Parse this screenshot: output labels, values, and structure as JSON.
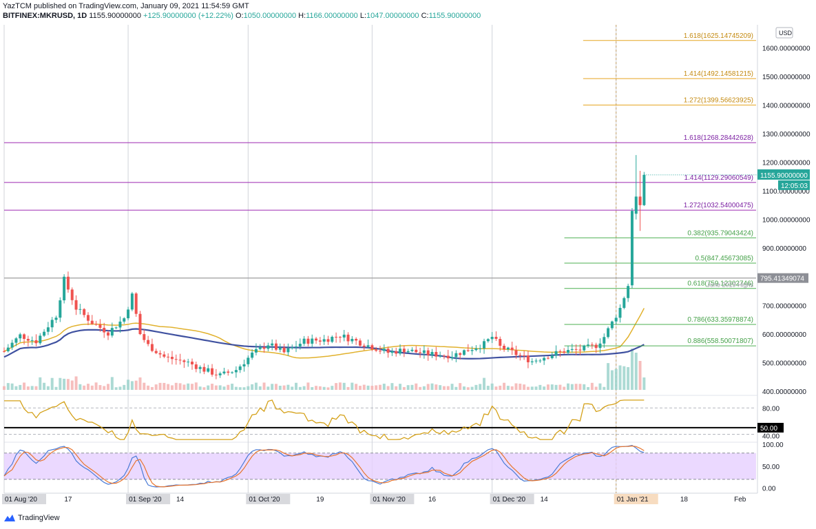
{
  "header": {
    "line1": "YazTCM published on TradingView.com, January 09, 2021 11:54:59 GMT",
    "symbol": "BITFINEX:MKRUSD, 1D",
    "last": "1155.90000000",
    "change": "+125.90000000 (+12.22%)",
    "open_label": "O:",
    "open": "1050.00000000",
    "high_label": "H:",
    "high": "1166.00000000",
    "low_label": "L:",
    "low": "1047.00000000",
    "close_label": "C:",
    "close": "1155.90000000"
  },
  "footer": {
    "brand": "TradingView"
  },
  "colors": {
    "up": "#26a69a",
    "down": "#ef5350",
    "fib_orange": "#e6a520",
    "fib_purple": "#9c27b0",
    "fib_green": "#4caf50",
    "ma_orange": "#e1b12c",
    "ma_blue": "#3f51a0",
    "rsi": "#d4a017",
    "stoch_k": "#4a7bd6",
    "stoch_d": "#e8742c",
    "stoch_band": "#e6d0ff"
  },
  "chart_data": {
    "type": "candlestick",
    "currency_badge": "USD",
    "price_axis": {
      "ylim": [
        400,
        1680
      ],
      "ticks": [
        {
          "v": 1600,
          "label": "1600.00000000"
        },
        {
          "v": 1500,
          "label": "1500.00000000"
        },
        {
          "v": 1400,
          "label": "1400.00000000"
        },
        {
          "v": 1300,
          "label": "1300.00000000"
        },
        {
          "v": 1200,
          "label": "1200.00000000"
        },
        {
          "v": 1100,
          "label": "1100.00000000"
        },
        {
          "v": 1000,
          "label": "1000.00000000"
        },
        {
          "v": 900,
          "label": "900.00000000"
        },
        {
          "v": 700,
          "label": "700.00000000"
        },
        {
          "v": 600,
          "label": "600.00000000"
        },
        {
          "v": 500,
          "label": "500.00000000"
        },
        {
          "v": 400,
          "label": "400.00000000"
        }
      ],
      "last_price_tag": {
        "v": 1155.9,
        "label": "1155.90000000",
        "countdown": "12:05:03"
      },
      "june_high_tag": {
        "v": 795.41349074,
        "label": "795.41349074",
        "note": "June 2019 Highs"
      }
    },
    "fib_levels": [
      {
        "v": 1625.14745209,
        "label": "1.618(1625.14745209)",
        "color": "#e6a520",
        "x_from": 0.77
      },
      {
        "v": 1492.14581215,
        "label": "1.414(1492.14581215)",
        "color": "#e6a520",
        "x_from": 0.77
      },
      {
        "v": 1399.56623925,
        "label": "1.272(1399.56623925)",
        "color": "#e6a520",
        "x_from": 0.77
      },
      {
        "v": 1268.28442628,
        "label": "1.618(1268.28442628)",
        "color": "#9c27b0",
        "x_from": 0.0
      },
      {
        "v": 1129.29060549,
        "label": "1.414(1129.29060549)",
        "color": "#9c27b0",
        "x_from": 0.0
      },
      {
        "v": 1032.54000475,
        "label": "1.272(1032.54000475)",
        "color": "#9c27b0",
        "x_from": 0.0
      },
      {
        "v": 935.79043424,
        "label": "0.382(935.79043424)",
        "color": "#4caf50",
        "x_from": 0.745
      },
      {
        "v": 847.45673085,
        "label": "0.5(847.45673085)",
        "color": "#4caf50",
        "x_from": 0.745
      },
      {
        "v": 759.12302746,
        "label": "0.618(759.12302746)",
        "color": "#4caf50",
        "x_from": 0.745
      },
      {
        "v": 633.35978874,
        "label": "0.786(633.35978874)",
        "color": "#4caf50",
        "x_from": 0.745
      },
      {
        "v": 558.50071807,
        "label": "0.886(558.50071807)",
        "color": "#4caf50",
        "x_from": 0.745
      }
    ],
    "x_axis": {
      "labels": [
        {
          "day": 0,
          "label": "01 Aug '20",
          "box": true
        },
        {
          "day": 16,
          "label": "17",
          "box": false
        },
        {
          "day": 31,
          "label": "01 Sep '20",
          "box": true
        },
        {
          "day": 44,
          "label": "14",
          "box": false
        },
        {
          "day": 61,
          "label": "01 Oct '20",
          "box": true
        },
        {
          "day": 79,
          "label": "19",
          "box": false
        },
        {
          "day": 92,
          "label": "01 Nov '20",
          "box": true
        },
        {
          "day": 107,
          "label": "16",
          "box": false
        },
        {
          "day": 122,
          "label": "01 Dec '20",
          "box": true
        },
        {
          "day": 135,
          "label": "14",
          "box": false
        },
        {
          "day": 153,
          "label": "01 Jan '21",
          "box": true,
          "highlight": true
        },
        {
          "day": 170,
          "label": "18",
          "box": false
        },
        {
          "day": 184,
          "label": "Feb",
          "box": false
        }
      ]
    },
    "candles": [],
    "rsi": {
      "ticks": [
        80,
        50,
        40
      ],
      "labels": [
        "80.00",
        "50.00",
        "40.00"
      ],
      "level_line": 50
    },
    "stoch": {
      "ticks": [
        100,
        50,
        0
      ],
      "labels": [
        "100.00",
        "50.00",
        "0.00"
      ],
      "band": [
        20,
        80
      ]
    }
  }
}
